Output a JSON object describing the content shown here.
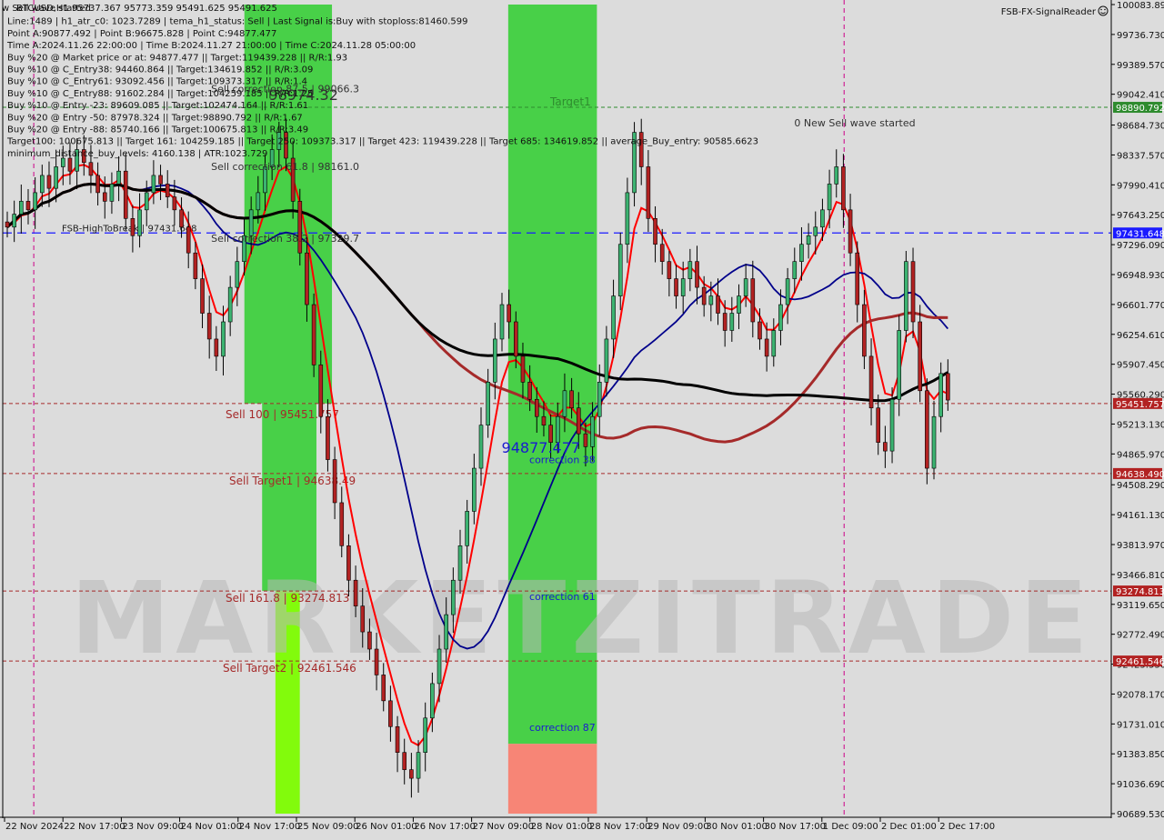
{
  "window": {
    "top_left_caption": "w Sell wave started",
    "indicator_name": "FSB-FX-SignalReader",
    "indicator_icon": "smiley-icon"
  },
  "info_panel": {
    "lines": [
      "BTCUSD,H1  95737.367 95773.359 95491.625 95491.625",
      "Line:1489 | h1_atr_c0: 1023.7289 | tema_h1_status: Sell | Last Signal is:Buy with stoploss:81460.599",
      "Point A:90877.492 | Point B:96675.828 | Point C:94877.477",
      "Time A:2024.11.26 22:00:00 | Time B:2024.11.27 21:00:00 | Time C:2024.11.28 05:00:00",
      "Buy %20 @ Market price or at: 94877.477 || Target:119439.228 || R/R:1.93",
      "Buy %10 @ C_Entry38: 94460.864 || Target:134619.852 || R/R:3.09",
      "Buy %10 @ C_Entry61: 93092.456 || Target:109373.317 || R/R:1.4",
      "Buy %10 @ C_Entry88: 91602.284 || Target:104259.185 || R/R:1.25",
      "Buy %10 @ Entry -23: 89609.085 || Target:102474.164 || R/R:1.61",
      "Buy %20 @ Entry -50: 87978.324 || Target:98890.792 || R/R:1.67",
      "Buy %20 @ Entry -88: 85740.166 || Target:100675.813 || R/R:3.49",
      "Target100: 100675.813 || Target 161: 104259.185 || Target 250: 109373.317 || Target 423: 119439.228 || Target 685: 134619.852 || average_Buy_entry: 90585.6623",
      "minimum_distance_buy_levels: 4160.138 | ATR:1023.729"
    ]
  },
  "chart_data": {
    "type": "candlestick",
    "symbol": "BTCUSD",
    "timeframe": "H1",
    "title": "BTCUSD,H1",
    "ohlc_last": {
      "open": 95737.367,
      "high": 95773.359,
      "low": 95491.625,
      "close": 95491.625
    },
    "ylim": [
      90689.53,
      100083.89
    ],
    "y_ticks": [
      100083.89,
      99736.73,
      99389.57,
      99042.41,
      98684.73,
      98337.57,
      97990.41,
      97643.25,
      97296.09,
      96948.93,
      96601.77,
      96254.61,
      95907.45,
      95560.29,
      95213.13,
      94865.97,
      94508.29,
      94161.13,
      93813.97,
      93466.81,
      93119.65,
      92772.49,
      92425.33,
      92078.17,
      91731.01,
      91383.85,
      91036.69,
      90689.53
    ],
    "x_ticks": [
      "22 Nov 2024",
      "22 Nov 17:00",
      "23 Nov 09:00",
      "24 Nov 01:00",
      "24 Nov 17:00",
      "25 Nov 09:00",
      "26 Nov 01:00",
      "26 Nov 17:00",
      "27 Nov 09:00",
      "28 Nov 01:00",
      "28 Nov 17:00",
      "29 Nov 09:00",
      "30 Nov 01:00",
      "30 Nov 17:00",
      "1 Dec 09:00",
      "2 Dec 01:00",
      "2 Dec 17:00"
    ],
    "price_tags": [
      {
        "label": "98890.792",
        "value": 98890.792,
        "color": "#2e8b2e"
      },
      {
        "label": "97431.648",
        "value": 97431.648,
        "color": "#1a1aff"
      },
      {
        "label": "95451.757",
        "value": 95451.757,
        "color": "#b22222"
      },
      {
        "label": "94638.490",
        "value": 94638.49,
        "color": "#b22222"
      },
      {
        "label": "93274.813",
        "value": 93274.813,
        "color": "#b22222"
      },
      {
        "label": "92461.546",
        "value": 92461.546,
        "color": "#b22222"
      }
    ],
    "horizontal_levels": [
      {
        "name": "target1",
        "value": 98890.792,
        "color": "#2e8b2e",
        "style": "dashed",
        "label": "Target1"
      },
      {
        "name": "high-to-break",
        "value": 97431.648,
        "color": "#1a1aff",
        "style": "dashed",
        "label": "FSB-HighToBreak | 97431.648"
      },
      {
        "name": "sell-100",
        "value": 95451.757,
        "color": "#a52a2a",
        "style": "dashed",
        "label": "Sell 100 | 95451.757"
      },
      {
        "name": "sell-target1",
        "value": 94638.49,
        "color": "#a52a2a",
        "style": "dashed",
        "label": "Sell Target1 | 94638.49"
      },
      {
        "name": "sell-161",
        "value": 93274.813,
        "color": "#a52a2a",
        "style": "dashed",
        "label": "Sell 161.8 | 93274.813"
      },
      {
        "name": "sell-target2",
        "value": 92461.546,
        "color": "#a52a2a",
        "style": "dashed",
        "label": "Sell Target2 | 92461.546"
      }
    ],
    "annotations": [
      {
        "text": "Sell correction 87.5 | 99066.3",
        "x_frac": 0.188,
        "value": 99066.3
      },
      {
        "text": "Sell correction 61.8 | 98161.0",
        "x_frac": 0.188,
        "value": 98161.0
      },
      {
        "text": "Sell correction 38.2 | 97329.7",
        "x_frac": 0.188,
        "value": 97329.7
      },
      {
        "text": "98974.32",
        "x_frac": 0.24,
        "value": 98974.32,
        "big": true
      },
      {
        "text": "94877.477",
        "x_frac": 0.45,
        "value": 94877.477,
        "big": true,
        "blue": true
      },
      {
        "text": "correction 38",
        "x_frac": 0.475,
        "value": 94760,
        "blue": true
      },
      {
        "text": "correction 61",
        "x_frac": 0.475,
        "value": 93170,
        "blue": true
      },
      {
        "text": "correction 87",
        "x_frac": 0.475,
        "value": 91650,
        "blue": true
      },
      {
        "text": "0 New Sell wave started",
        "x_frac": 0.714,
        "value": 98670
      }
    ],
    "series_close": [
      97500,
      97650,
      97800,
      97700,
      97900,
      98100,
      97950,
      98200,
      98300,
      98150,
      98400,
      98250,
      98100,
      97900,
      97800,
      98000,
      98150,
      97600,
      97400,
      97700,
      97900,
      98100,
      98000,
      97850,
      97700,
      97500,
      97200,
      96900,
      96500,
      96200,
      96000,
      96400,
      96800,
      97100,
      97400,
      97700,
      97900,
      98200,
      98400,
      98600,
      98300,
      97800,
      97200,
      96600,
      95900,
      95300,
      94800,
      94300,
      93800,
      93400,
      93100,
      92800,
      92600,
      92300,
      92000,
      91700,
      91400,
      91200,
      91100,
      91400,
      91800,
      92200,
      92600,
      93000,
      93400,
      93800,
      94200,
      94700,
      95200,
      95700,
      96200,
      96600,
      96400,
      96000,
      95700,
      95500,
      95300,
      95200,
      95000,
      95300,
      95600,
      95400,
      95100,
      94950,
      95300,
      95700,
      96200,
      96700,
      97300,
      97900,
      98600,
      98200,
      97600,
      97300,
      97100,
      96900,
      96700,
      96900,
      97100,
      96800,
      96600,
      96700,
      96500,
      96300,
      96500,
      96700,
      96900,
      96400,
      96200,
      96000,
      96300,
      96600,
      96900,
      97100,
      97300,
      97400,
      97500,
      97700,
      98000,
      98200,
      97700,
      97200,
      96600,
      96000,
      95400,
      95000,
      94900,
      95500,
      96300,
      97100,
      96400,
      95600,
      94700,
      95300,
      95800,
      95491.625
    ],
    "moving_averages": [
      {
        "name": "ema-red",
        "color": "#ff0000"
      },
      {
        "name": "sma-navy",
        "color": "#00008b"
      },
      {
        "name": "sma-brown",
        "color": "#a52a2a"
      },
      {
        "name": "sma-black",
        "color": "#000000"
      }
    ],
    "zones": [
      {
        "name": "zone-green-1",
        "x_from": 0.218,
        "x_to": 0.297,
        "from": 95451.757,
        "to": 100083.89,
        "color": "#3fcf3f"
      },
      {
        "name": "zone-green-2",
        "x_from": 0.234,
        "x_to": 0.283,
        "from": 93274.813,
        "to": 95451.757,
        "color": "#3fcf3f"
      },
      {
        "name": "zone-lime-1",
        "x_from": 0.246,
        "x_to": 0.268,
        "from": 90689.53,
        "to": 93274.813,
        "color": "#7cfc00"
      },
      {
        "name": "zone-green-3",
        "x_from": 0.456,
        "x_to": 0.536,
        "from": 91500,
        "to": 100083.89,
        "color": "#3fcf3f"
      },
      {
        "name": "zone-salmon-1",
        "x_from": 0.456,
        "x_to": 0.536,
        "from": 90689.53,
        "to": 91500,
        "color": "#f88070"
      }
    ],
    "vertical_markers": [
      {
        "name": "vline-magenta-1",
        "x_frac": 0.028,
        "color": "#cc0088"
      },
      {
        "name": "vline-magenta-2",
        "x_frac": 0.759,
        "color": "#cc0088"
      }
    ],
    "watermark": "MARKETZITRADE"
  },
  "colors": {
    "background": "#dcdcdc",
    "bull_candle": "#3cb371",
    "bear_candle": "#b22222",
    "axis": "#000000"
  }
}
